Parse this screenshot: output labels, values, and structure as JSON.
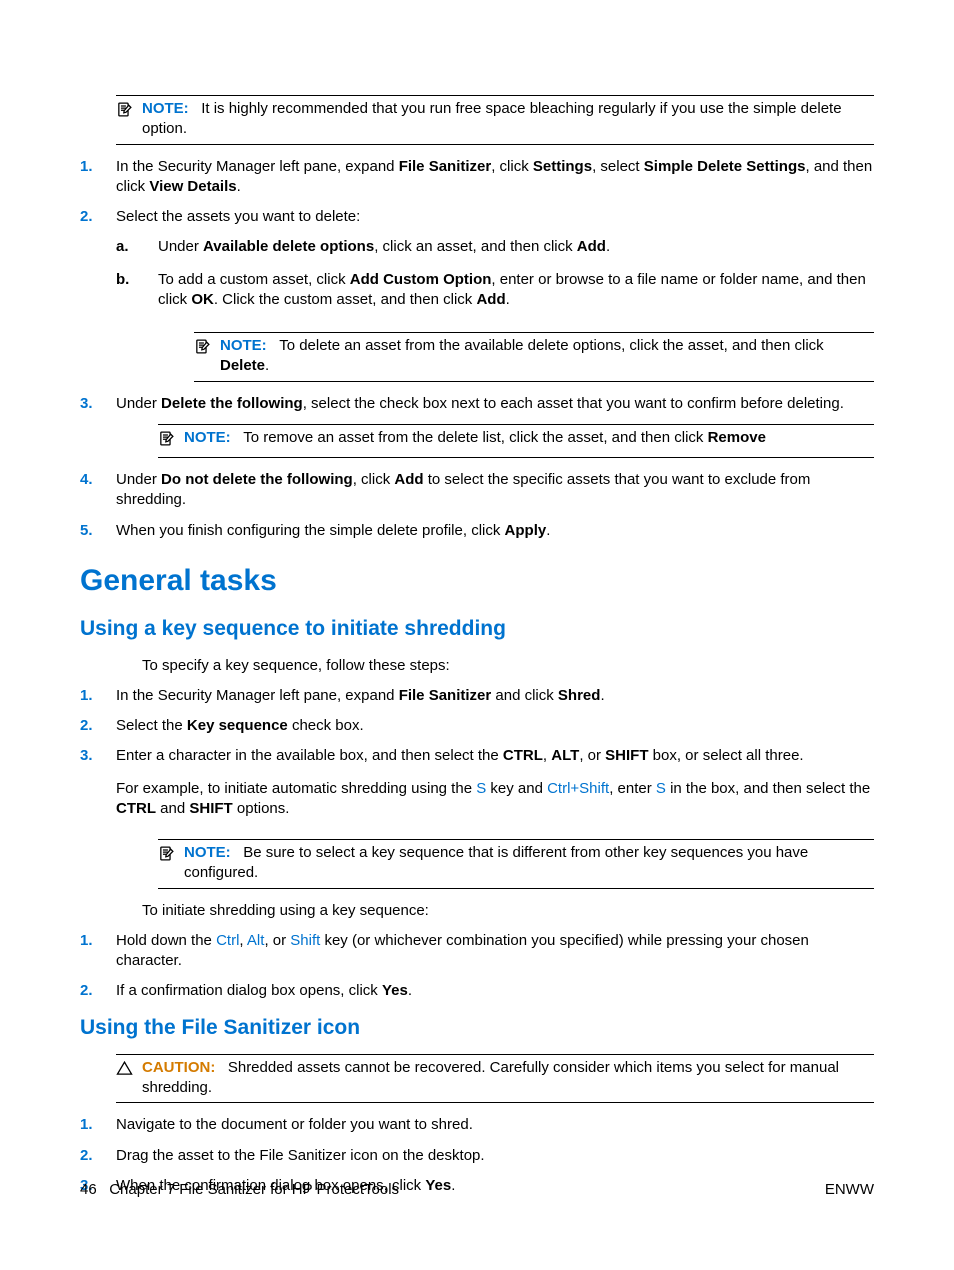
{
  "note0": {
    "label": "NOTE:",
    "text_a": "It is highly recommended that you run free space bleaching regularly if you use the simple delete option."
  },
  "list1": {
    "n1": "1.",
    "i1": {
      "a": "In the Security Manager left pane, expand ",
      "b1": "File Sanitizer",
      "b": ", click ",
      "b2": "Settings",
      "c": ", select ",
      "b3": "Simple Delete Settings",
      "d": ", and then click ",
      "b4": "View Details",
      "e": "."
    },
    "n2": "2.",
    "i2": "Select the assets you want to delete:",
    "sub": {
      "na": "a.",
      "a": {
        "p1": "Under ",
        "b1": "Available delete options",
        "p2": ", click an asset, and then click ",
        "b2": "Add",
        "p3": "."
      },
      "nb": "b.",
      "b": {
        "p1": "To add a custom asset, click ",
        "b1": "Add Custom Option",
        "p2": ", enter or browse to a file name or folder name, and then click ",
        "b2": "OK",
        "p3": ". Click the custom asset, and then click ",
        "b3": "Add",
        "p4": "."
      }
    },
    "note_sub": {
      "label": "NOTE:",
      "a": "To delete an asset from the available delete options, click the asset, and then click ",
      "b1": "Delete",
      "b": "."
    },
    "n3": "3.",
    "i3": {
      "a": "Under ",
      "b1": "Delete the following",
      "b": ", select the check box next to each asset that you want to confirm before deleting."
    },
    "note_3": {
      "label": "NOTE:",
      "a": "To remove an asset from the delete list, click the asset, and then click ",
      "b1": "Remove"
    },
    "n4": "4.",
    "i4": {
      "a": "Under ",
      "b1": "Do not delete the following",
      "b": ", click ",
      "b2": "Add",
      "c": " to select the specific assets that you want to exclude from shredding."
    },
    "n5": "5.",
    "i5": {
      "a": "When you finish configuring the simple delete profile, click ",
      "b1": "Apply",
      "b": "."
    }
  },
  "h1": "General tasks",
  "h2a": "Using a key sequence to initiate shredding",
  "p_intro": "To specify a key sequence, follow these steps:",
  "list2": {
    "n1": "1.",
    "i1": {
      "a": "In the Security Manager left pane, expand ",
      "b1": "File Sanitizer",
      "b": " and click ",
      "b2": "Shred",
      "c": "."
    },
    "n2": "2.",
    "i2": {
      "a": "Select the ",
      "b1": "Key sequence",
      "b": " check box."
    },
    "n3": "3.",
    "i3": {
      "a": "Enter a character in the available box, and then select the ",
      "b1": "CTRL",
      "b": ", ",
      "b2": "ALT",
      "c": ", or ",
      "b3": "SHIFT",
      "d": " box, or select all three."
    },
    "i3_ex": {
      "a": "For example, to initiate automatic shredding using the ",
      "k1": "S",
      "b": " key and ",
      "k2": "Ctrl+Shift",
      "c": ", enter ",
      "k3": "S",
      "d": " in the box, and then select the ",
      "b1": "CTRL",
      "e": " and ",
      "b2": "SHIFT",
      "f": " options."
    },
    "note": {
      "label": "NOTE:",
      "a": "Be sure to select a key sequence that is different from other key sequences you have configured."
    }
  },
  "p_init": "To initiate shredding using a key sequence:",
  "list3": {
    "n1": "1.",
    "i1": {
      "a": "Hold down the ",
      "k1": "Ctrl",
      "b": ", ",
      "k2": "Alt",
      "c": ", or ",
      "k3": "Shift",
      "d": " key (or whichever combination you specified) while pressing your chosen character."
    },
    "n2": "2.",
    "i2": {
      "a": "If a confirmation dialog box opens, click ",
      "b1": "Yes",
      "b": "."
    }
  },
  "h2b": "Using the File Sanitizer icon",
  "caution": {
    "label": "CAUTION:",
    "a": "Shredded assets cannot be recovered. Carefully consider which items you select for manual shredding."
  },
  "list4": {
    "n1": "1.",
    "i1": "Navigate to the document or folder you want to shred.",
    "n2": "2.",
    "i2": "Drag the asset to the File Sanitizer icon on the desktop.",
    "n3": "3.",
    "i3": {
      "a": "When the confirmation dialog box opens, click ",
      "b1": "Yes",
      "b": "."
    }
  },
  "footer": {
    "pagenum": "46",
    "chapter": "Chapter 7   File Sanitizer for HP ProtectTools",
    "right": "ENWW"
  }
}
